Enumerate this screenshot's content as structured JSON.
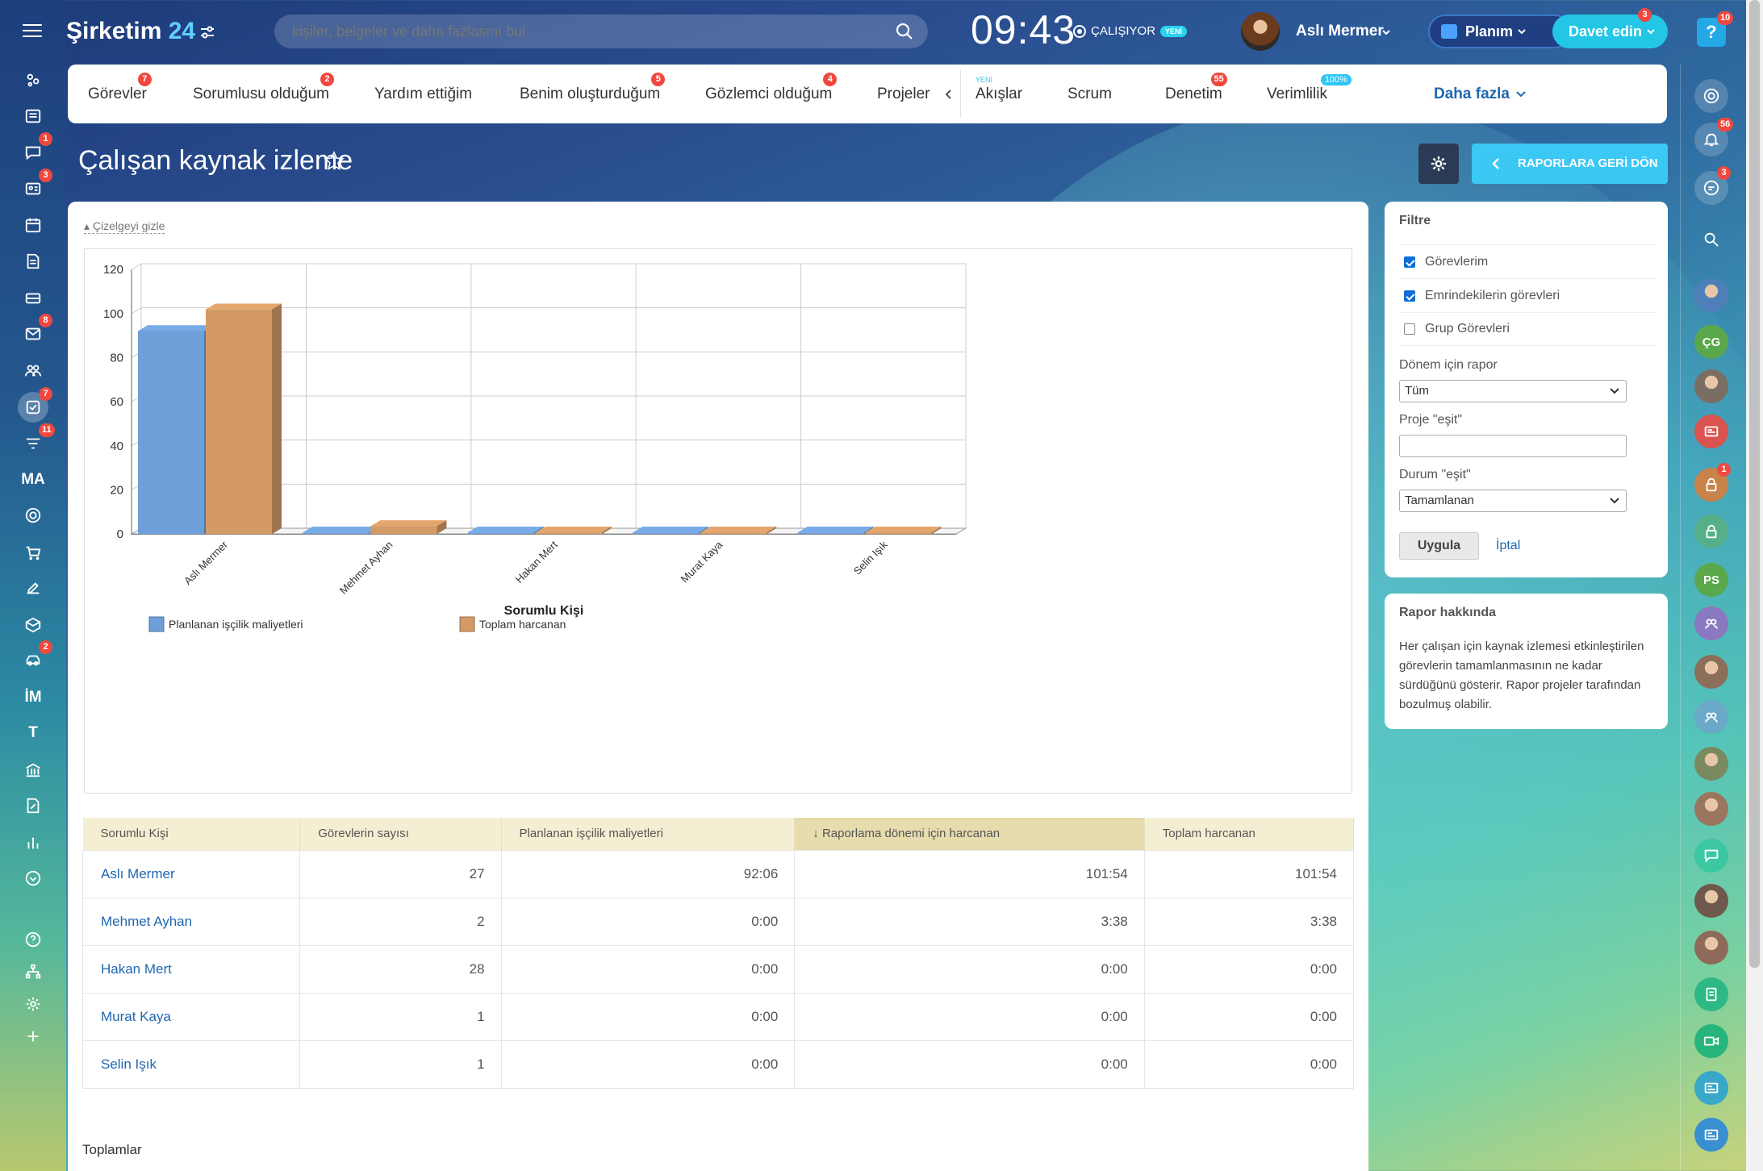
{
  "header": {
    "logo": "Şirketim",
    "logo_num": "24",
    "search_placeholder": "kişiler, belgeler ve daha fazlasını bul",
    "clock": "09:43",
    "status": "ÇALIŞIYOR",
    "status_badge": "YENİ",
    "user": "Aslı Mermer",
    "planim": "Planım",
    "invite": "Davet edin",
    "invite_badge": "3",
    "help": "?",
    "help_badge": "10"
  },
  "left_nav": [
    {
      "icon": "activity-icon"
    },
    {
      "icon": "feed-icon"
    },
    {
      "icon": "chat-icon",
      "badge": "1"
    },
    {
      "icon": "contact-card-icon",
      "badge": "3"
    },
    {
      "icon": "calendar-icon"
    },
    {
      "icon": "document-icon"
    },
    {
      "icon": "drive-icon"
    },
    {
      "icon": "mail-icon",
      "badge": "8"
    },
    {
      "icon": "group-icon"
    },
    {
      "icon": "tasks-icon",
      "badge": "7"
    },
    {
      "icon": "funnel-icon",
      "badge": "11"
    },
    {
      "icon": "ma-text",
      "text": "MA"
    },
    {
      "icon": "target-icon"
    },
    {
      "icon": "cart-icon"
    },
    {
      "icon": "sign-icon"
    },
    {
      "icon": "box-icon"
    },
    {
      "icon": "car-icon",
      "badge": "2"
    },
    {
      "icon": "im-text",
      "text": "İM"
    },
    {
      "icon": "t-text",
      "text": "T"
    },
    {
      "icon": "bank-icon"
    },
    {
      "icon": "edit-doc-icon"
    },
    {
      "icon": "bar-chart-icon"
    },
    {
      "icon": "chevron-circle-icon"
    },
    {
      "icon": "help-circle-icon"
    },
    {
      "icon": "sitemap-icon"
    },
    {
      "icon": "settings-icon"
    },
    {
      "icon": "plus-icon"
    }
  ],
  "tabs": [
    {
      "label": "Görevler",
      "badge": "7"
    },
    {
      "label": "Sorumlusu olduğum",
      "badge": "2"
    },
    {
      "label": "Yardım ettiğim"
    },
    {
      "label": "Benim oluşturduğum",
      "badge": "5"
    },
    {
      "label": "Gözlemci olduğum",
      "badge": "4"
    },
    {
      "label": "Projeler"
    },
    {
      "label": "Akışlar",
      "small": "YENİ"
    },
    {
      "label": "Scrum"
    },
    {
      "label": "Denetim",
      "badge": "55"
    },
    {
      "label": "Verimlilik",
      "pct": "100%"
    },
    {
      "label": "Daha fazla"
    }
  ],
  "page": {
    "title": "Çalışan kaynak izleme",
    "back_button": "RAPORLARA GERİ DÖN",
    "hide_chart": "Çizelgeyi gizle",
    "totals_label": "Toplamlar"
  },
  "chart_data": {
    "type": "bar",
    "categories": [
      "Aslı Mermer",
      "Mehmet Ayhan",
      "Hakan Mert",
      "Murat Kaya",
      "Selin Işık"
    ],
    "series": [
      {
        "name": "Planlanan işçilik maliyetleri",
        "values": [
          92.1,
          0,
          0,
          0,
          0
        ],
        "color": "#6f9fd8"
      },
      {
        "name": "Toplam harcanan",
        "values": [
          101.9,
          3.6,
          0,
          0,
          0
        ],
        "color": "#d49a66"
      }
    ],
    "xlabel": "Sorumlu Kişi",
    "ylabel": "",
    "ylim": [
      0,
      120
    ],
    "yticks": [
      0,
      20,
      40,
      60,
      80,
      100,
      120
    ],
    "grid": true,
    "legend": "bottom-left"
  },
  "table": {
    "headers": [
      "Sorumlu Kişi",
      "Görevlerin sayısı",
      "Planlanan işçilik maliyetleri",
      "↓ Raporlama dönemi için harcanan",
      "Toplam harcanan"
    ],
    "rows": [
      [
        "Aslı Mermer",
        "27",
        "92:06",
        "101:54",
        "101:54"
      ],
      [
        "Mehmet Ayhan",
        "2",
        "0:00",
        "3:38",
        "3:38"
      ],
      [
        "Hakan Mert",
        "28",
        "0:00",
        "0:00",
        "0:00"
      ],
      [
        "Murat Kaya",
        "1",
        "0:00",
        "0:00",
        "0:00"
      ],
      [
        "Selin Işık",
        "1",
        "0:00",
        "0:00",
        "0:00"
      ]
    ]
  },
  "filter": {
    "title": "Filtre",
    "checkboxes": [
      {
        "label": "Görevlerim",
        "checked": true
      },
      {
        "label": "Emrindekilerin görevleri",
        "checked": true
      },
      {
        "label": "Grup Görevleri",
        "checked": false
      }
    ],
    "period_label": "Dönem için rapor",
    "period_value": "Tüm",
    "project_label": "Proje \"eşit\"",
    "project_value": "",
    "status_label": "Durum \"eşit\"",
    "status_value": "Tamamlanan",
    "apply": "Uygula",
    "cancel": "İptal"
  },
  "about": {
    "title": "Rapor hakkında",
    "text": "Her çalışan için kaynak izlemesi etkinleştirilen görevlerin tamamlanmasının ne kadar sürdüğünü gösterir. Rapor projeler tarafından bozulmuş olabilir."
  },
  "right_nav": [
    {
      "icon": "target-icon"
    },
    {
      "icon": "bell-icon",
      "badge": "56"
    },
    {
      "icon": "chat-bubble-icon",
      "badge": "3"
    },
    {
      "icon": "search-icon"
    },
    {
      "icon": "avatar-1"
    },
    {
      "icon": "initials",
      "text": "ÇG"
    },
    {
      "icon": "avatar-2"
    },
    {
      "icon": "news-icon"
    },
    {
      "icon": "lock-icon",
      "badge": "1"
    },
    {
      "icon": "lock-icon-2"
    },
    {
      "icon": "initials",
      "text": "PS"
    },
    {
      "icon": "group-avatar-icon"
    },
    {
      "icon": "avatar-3"
    },
    {
      "icon": "group-avatar-icon-2"
    },
    {
      "icon": "avatar-4"
    },
    {
      "icon": "avatar-5"
    },
    {
      "icon": "message-icon"
    },
    {
      "icon": "avatar-6"
    },
    {
      "icon": "avatar-7"
    },
    {
      "icon": "doc-green-icon"
    },
    {
      "icon": "video-icon"
    },
    {
      "icon": "card-icon"
    },
    {
      "icon": "card-icon-2"
    }
  ],
  "colors": {
    "accent": "#2fc6f6",
    "badge": "#f0483e",
    "link": "#2067b0"
  }
}
